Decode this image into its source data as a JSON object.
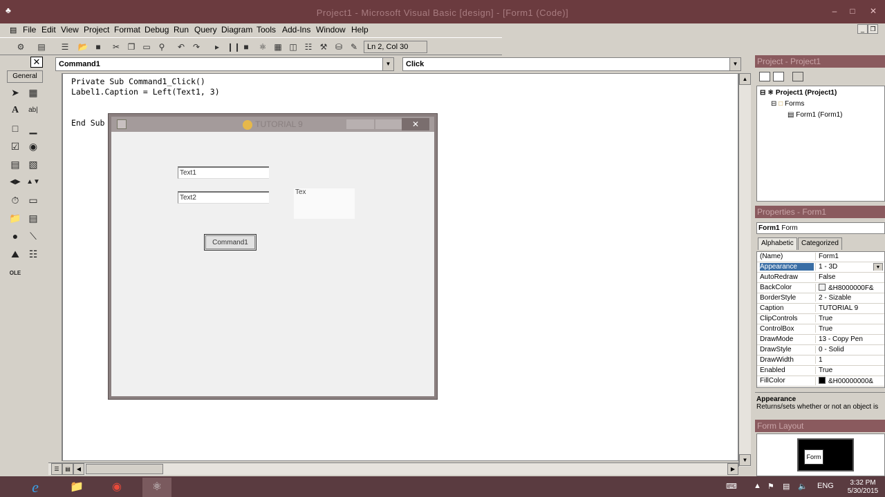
{
  "window": {
    "title": "Project1 - Microsoft Visual Basic [design] - [Form1 (Code)]"
  },
  "menu": [
    "File",
    "Edit",
    "View",
    "Project",
    "Format",
    "Debug",
    "Run",
    "Query",
    "Diagram",
    "Tools",
    "Add-Ins",
    "Window",
    "Help"
  ],
  "toolbar": {
    "position": "Ln 2, Col 30"
  },
  "toolbox": {
    "tab": "General"
  },
  "code": {
    "object": "Command1",
    "procedure": "Click",
    "lines": [
      "Private Sub Command1_Click()",
      "Label1.Caption = Left(Text1, 3)",
      "",
      "End Sub"
    ]
  },
  "runtime_form": {
    "title": "TUTORIAL 9",
    "text1": "Text1",
    "text2": "Text2",
    "label": "Tex",
    "button": "Command1"
  },
  "project": {
    "title": "Project - Project1",
    "root": "Project1 (Project1)",
    "folder": "Forms",
    "item": "Form1 (Form1)"
  },
  "properties": {
    "title": "Properties - Form1",
    "object": "Form1",
    "object_type": "Form",
    "tabs": [
      "Alphabetic",
      "Categorized"
    ],
    "rows": [
      {
        "name": "(Name)",
        "value": "Form1"
      },
      {
        "name": "Appearance",
        "value": "1 - 3D",
        "selected": true
      },
      {
        "name": "AutoRedraw",
        "value": "False"
      },
      {
        "name": "BackColor",
        "value": "&H8000000F&",
        "swatch": "#f0f0f0"
      },
      {
        "name": "BorderStyle",
        "value": "2 - Sizable"
      },
      {
        "name": "Caption",
        "value": "TUTORIAL 9"
      },
      {
        "name": "ClipControls",
        "value": "True"
      },
      {
        "name": "ControlBox",
        "value": "True"
      },
      {
        "name": "DrawMode",
        "value": "13 - Copy Pen"
      },
      {
        "name": "DrawStyle",
        "value": "0 - Solid"
      },
      {
        "name": "DrawWidth",
        "value": "1"
      },
      {
        "name": "Enabled",
        "value": "True"
      },
      {
        "name": "FillColor",
        "value": "&H00000000&",
        "swatch": "#000000"
      }
    ],
    "desc_title": "Appearance",
    "desc_text": "Returns/sets whether or not an object is"
  },
  "form_layout": {
    "title": "Form Layout",
    "form_label": "Form"
  },
  "taskbar": {
    "lang": "ENG",
    "time": "3:32 PM",
    "date": "5/30/2015"
  },
  "colors": {
    "titlebar": "#6b3b3f",
    "taskbar": "#5a3b40",
    "selection": "#3a6ea5"
  }
}
